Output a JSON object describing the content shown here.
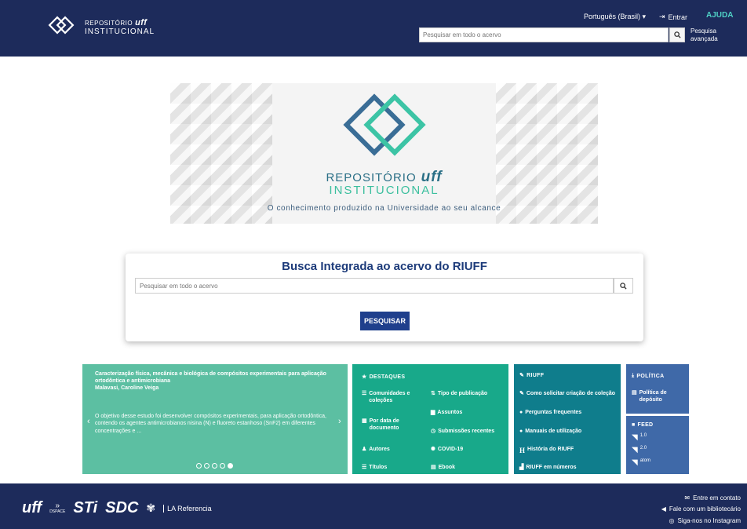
{
  "header": {
    "logo_line1": "REPOSITÓRIO",
    "logo_uff": "uff",
    "logo_line2": "INSTITUCIONAL",
    "language": "Português (Brasil)",
    "login": "Entrar",
    "help": "AJUDA",
    "search_placeholder": "Pesquisar em todo o acervo",
    "advanced_search": "Pesquisa avançada"
  },
  "banner": {
    "title1": "REPOSITÓRIO",
    "title1_brand": "uff",
    "title2": "INSTITUCIONAL",
    "tagline": "O conhecimento produzido na Universidade ao seu alcance"
  },
  "search_card": {
    "heading": "Busca Integrada ao acervo do RIUFF",
    "placeholder": "Pesquisar em todo o acervo",
    "submit": "PESQUISAR"
  },
  "carousel": {
    "title": "Caracterização física, mecânica e biológica de compósitos experimentais para aplicação ortodôntica e antimicrobiana",
    "authors": "Malavasi, Caroline Veiga",
    "abstract": "O objetivo desse estudo foi desenvolver compósitos experimentais, para aplicação ortodôntica, contendo os agentes antimicrobianos nisina (N) e fluoreto estanhoso (SnF2) em diferentes concentrações e ...",
    "slides": 5,
    "active_slide": 5
  },
  "destaques": {
    "title": "DESTAQUES",
    "items": [
      {
        "label": "Comunidades e coleções",
        "icon": "list-icon"
      },
      {
        "label": "Tipo de publicação",
        "icon": "sort-icon"
      },
      {
        "label": "Assuntos",
        "icon": "file-icon"
      },
      {
        "label": "Por data de documento",
        "icon": "calendar-icon"
      },
      {
        "label": "Submissões recentes",
        "icon": "clock-icon"
      },
      {
        "label": "Autores",
        "icon": "user-icon"
      },
      {
        "label": "COVID-19",
        "icon": "virus-icon"
      },
      {
        "label": "Títulos",
        "icon": "list-icon"
      },
      {
        "label": "Ebook",
        "icon": "book-icon"
      }
    ]
  },
  "riuff": {
    "title": "RIUFF",
    "items": [
      {
        "label": "Como solicitar criação de coleção",
        "icon": "edit-icon"
      },
      {
        "label": "Perguntas frequentes",
        "icon": "question-icon"
      },
      {
        "label": "Manuais de utilização",
        "icon": "info-icon"
      },
      {
        "label": "História do RIUFF",
        "icon": "h-icon"
      },
      {
        "label": "RIUFF em números",
        "icon": "bar-chart-icon"
      }
    ]
  },
  "politica": {
    "title": "POLÍTICA",
    "item": "Política de depósito"
  },
  "feed": {
    "title": "FEED",
    "items": [
      "1.0",
      "2.0",
      "atom"
    ]
  },
  "footer": {
    "uff": "uff",
    "dspace": "DSPACE",
    "sti": "STi",
    "sdc": "SDC",
    "la": "LA Referencia",
    "contact": "Entre em contato",
    "librarian": "Fale com um bibliotecário",
    "instagram": "Siga-nos no Instagram"
  },
  "colors": {
    "header_bg": "#1d2b5b",
    "help": "#4fd1c5",
    "carousel_bg": "#5cbfa2",
    "destaques_bg": "#18a98a",
    "riuff_bg": "#0f7d8c",
    "politica_bg": "#3f69a8",
    "button_bg": "#1f3f8c"
  }
}
